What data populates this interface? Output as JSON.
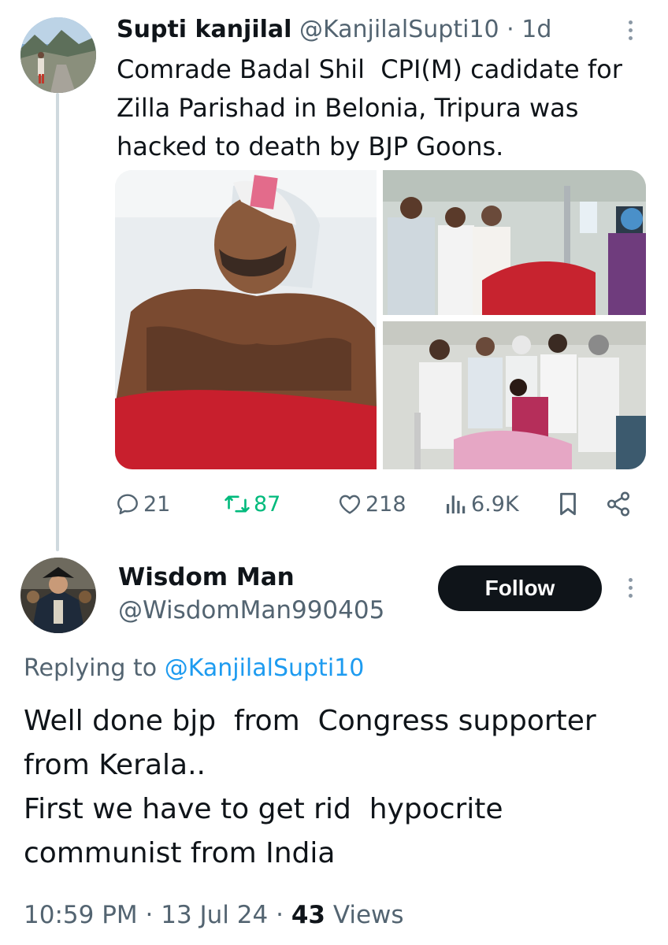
{
  "thread": {
    "original_post": {
      "display_name": "Supti kanjilal",
      "handle": "@KanjilalSupti10",
      "separator": "·",
      "time_ago": "1d",
      "text": "Comrade Badal Shil  CPI(M) cadidate for\nZilla Parishad in Belonia, Tripura was\nhacked to death by BJP Goons.",
      "media": [
        {
          "label": "photo-patient-in-bed"
        },
        {
          "label": "photo-visitors-at-bedside"
        },
        {
          "label": "photo-crowd-around-patient"
        }
      ],
      "stats": {
        "replies": "21",
        "reposts": "87",
        "likes": "218",
        "views": "6.9K"
      },
      "colors": {
        "repost_active": "#00ba7c",
        "muted": "#536471"
      }
    },
    "reply_post": {
      "display_name": "Wisdom Man",
      "handle": "@WisdomMan990405",
      "follow_label": "Follow",
      "replying_prefix": "Replying to",
      "replying_to": "@KanjilalSupti10",
      "text": "Well done bjp  from  Congress supporter\nfrom Kerala..\nFirst we have to get rid  hypocrite\ncommunist from India",
      "time": "10:59 PM",
      "date": "13 Jul 24",
      "separator": "·",
      "views_count": "43",
      "views_label": "Views"
    }
  },
  "icons": [
    "reply-icon",
    "repost-icon",
    "like-icon",
    "views-icon",
    "bookmark-icon",
    "share-icon",
    "more-icon"
  ]
}
